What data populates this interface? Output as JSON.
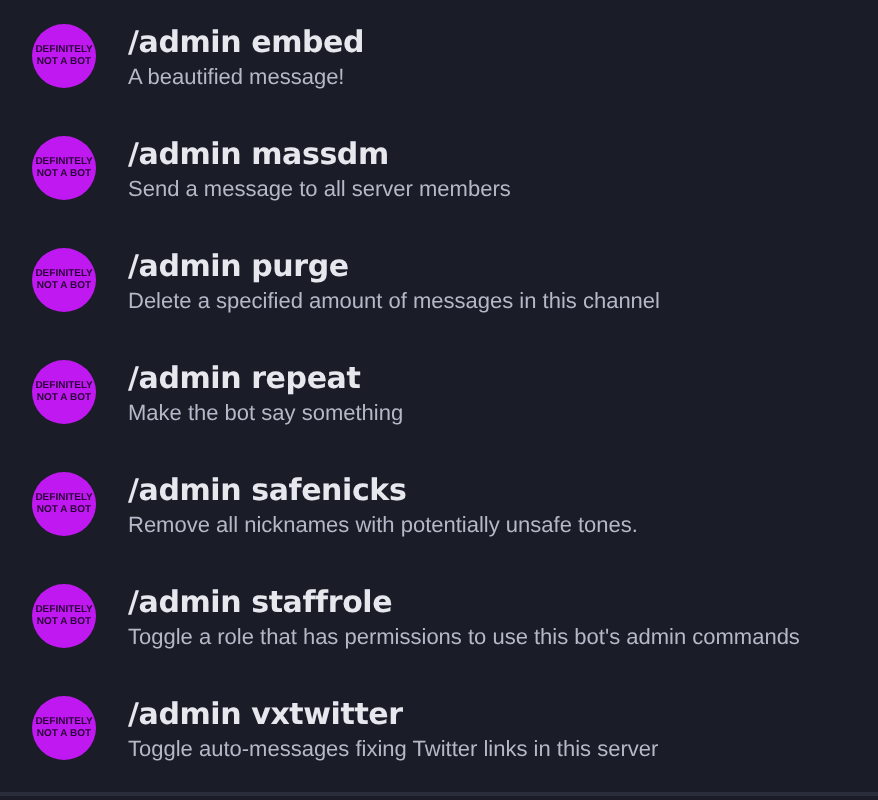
{
  "commands": [
    {
      "avatar_text": "DEFINITELY NOT A BOT",
      "name": "/admin embed",
      "description": "A beautified message!"
    },
    {
      "avatar_text": "DEFINITELY NOT A BOT",
      "name": "/admin massdm",
      "description": "Send a message to all server members"
    },
    {
      "avatar_text": "DEFINITELY NOT A BOT",
      "name": "/admin purge",
      "description": "Delete a specified amount of messages in this channel"
    },
    {
      "avatar_text": "DEFINITELY NOT A BOT",
      "name": "/admin repeat",
      "description": "Make the bot say something"
    },
    {
      "avatar_text": "DEFINITELY NOT A BOT",
      "name": "/admin safenicks",
      "description": "Remove all nicknames with potentially unsafe tones."
    },
    {
      "avatar_text": "DEFINITELY NOT A BOT",
      "name": "/admin staffrole",
      "description": "Toggle a role that has permissions to use this bot's admin commands"
    },
    {
      "avatar_text": "DEFINITELY NOT A BOT",
      "name": "/admin vxtwitter",
      "description": "Toggle auto-messages fixing Twitter links in this server"
    }
  ]
}
